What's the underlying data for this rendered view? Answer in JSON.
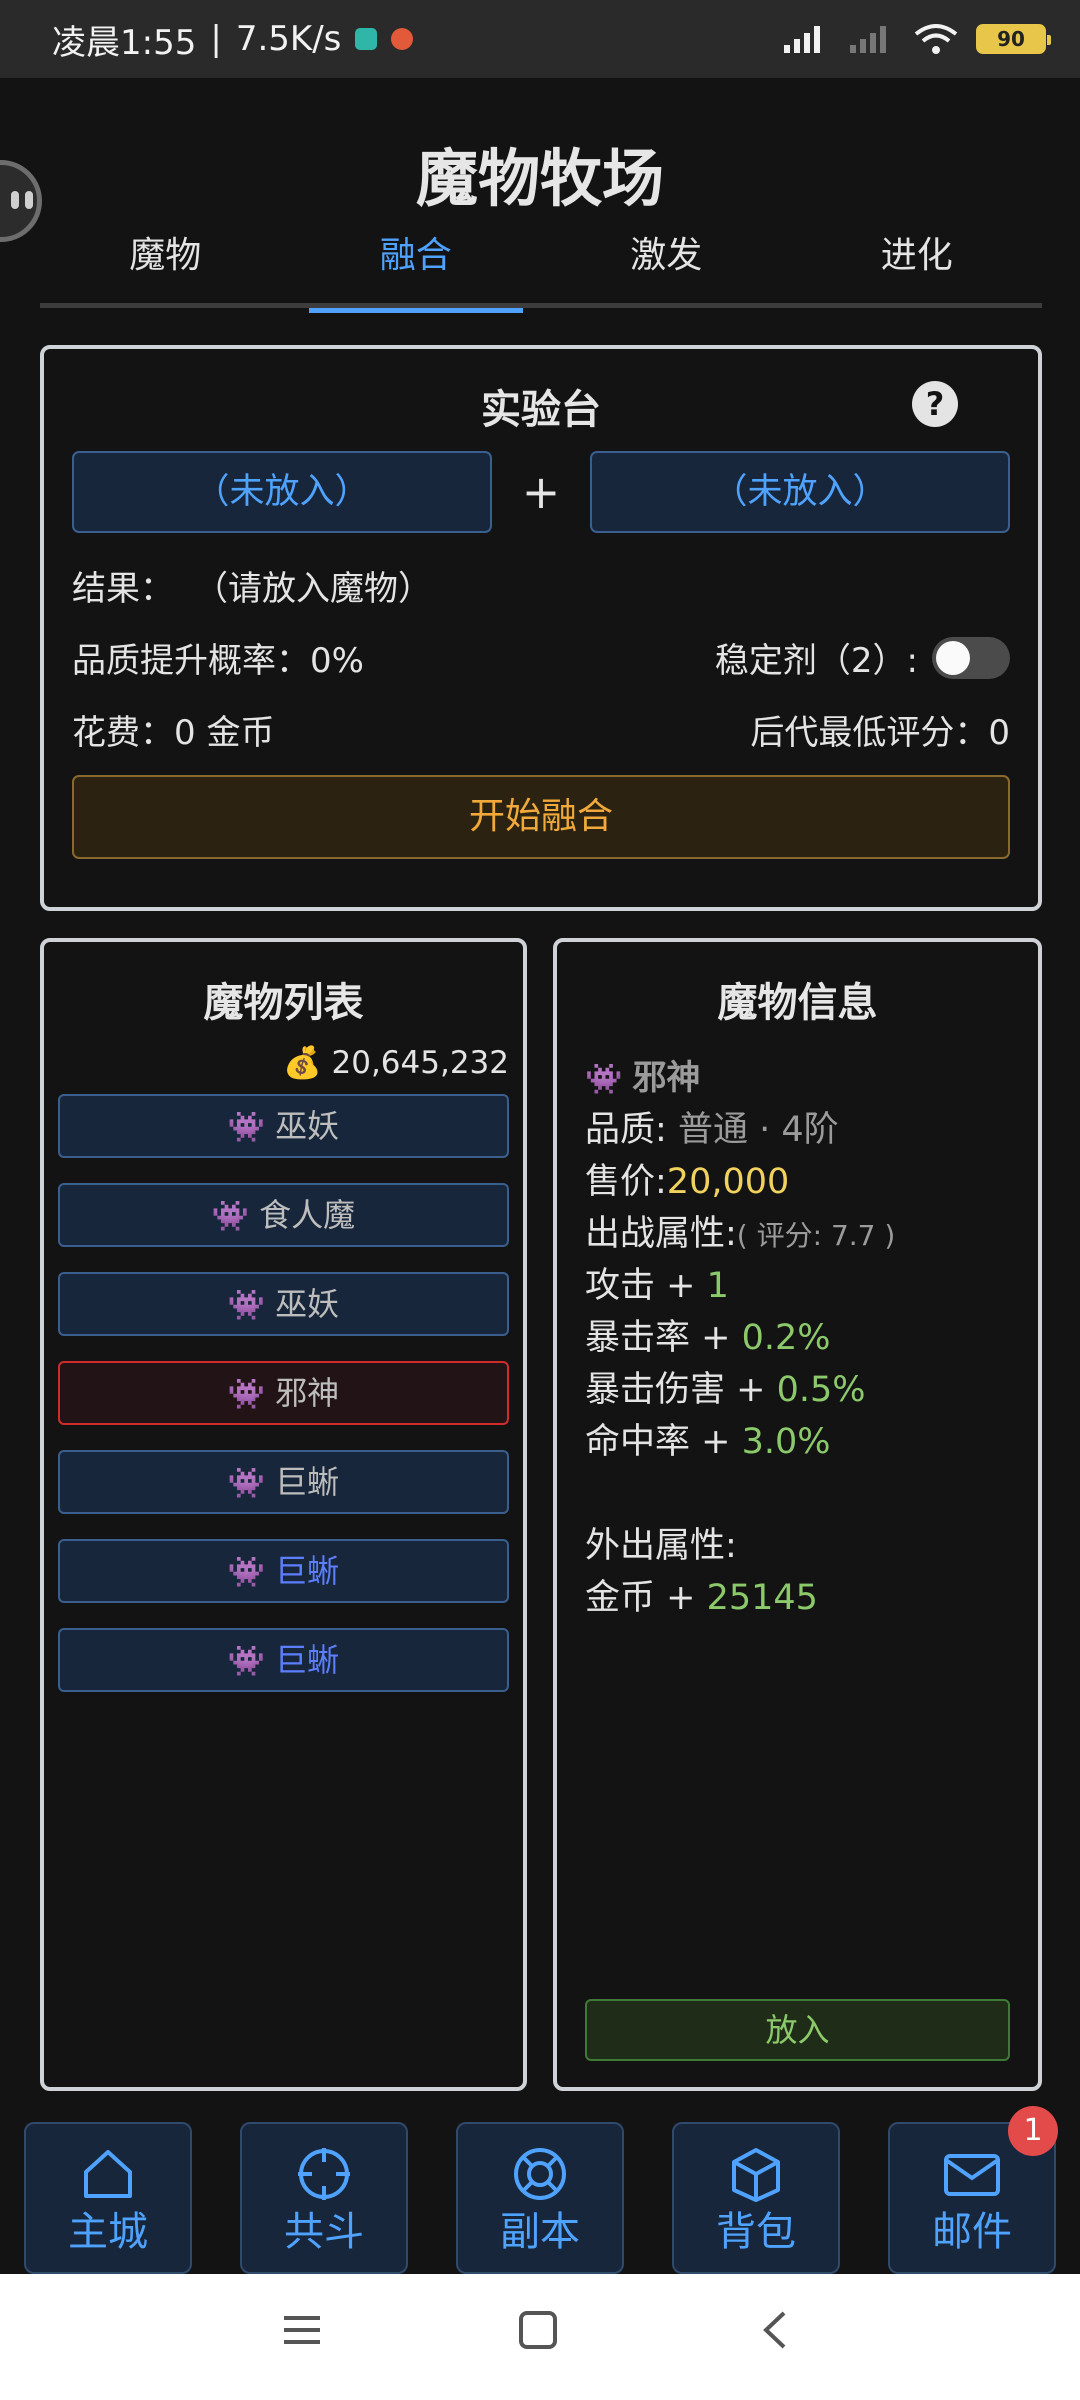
{
  "status_bar": {
    "time": "凌晨1:55",
    "speed": "7.5K/s",
    "battery": "90"
  },
  "page_title": "魔物牧场",
  "tabs": [
    {
      "label": "魔物"
    },
    {
      "label": "融合"
    },
    {
      "label": "激发"
    },
    {
      "label": "进化"
    }
  ],
  "lab": {
    "title": "实验台",
    "help": "?",
    "slot_a": "（未放入）",
    "plus": "+",
    "slot_b": "（未放入）",
    "result_label": "结果：",
    "result_value": "（请放入魔物）",
    "quality_rate": "品质提升概率：0%",
    "stabilizer": "稳定剂（2）:",
    "stabilizer_on": false,
    "cost": "花费：0 金币",
    "min_score": "后代最低评分：0",
    "start_button": "开始融合"
  },
  "monster_list": {
    "title": "魔物列表",
    "gold_icon": "💰",
    "gold": "20,645,232",
    "items": [
      {
        "icon": "👾",
        "name": "巫妖"
      },
      {
        "icon": "👾",
        "name": "食人魔"
      },
      {
        "icon": "👾",
        "name": "巫妖"
      },
      {
        "icon": "👾",
        "name": "邪神"
      },
      {
        "icon": "👾",
        "name": "巨蜥"
      },
      {
        "icon": "👾",
        "name": "巨蜥"
      },
      {
        "icon": "👾",
        "name": "巨蜥"
      }
    ],
    "selected_index": 3
  },
  "monster_info": {
    "title": "魔物信息",
    "icon": "👾",
    "name": "邪神",
    "quality_label": "品质:",
    "quality_value": "普通 · 4阶",
    "price_label": "售价:",
    "price_value": "20,000",
    "battle_attr_label": "出战属性:",
    "battle_score": "( 评分: 7.7 )",
    "attack_label": "攻击 +",
    "attack_value": "1",
    "crit_rate_label": "暴击率 +",
    "crit_rate_value": "0.2%",
    "crit_dmg_label": "暴击伤害 +",
    "crit_dmg_value": "0.5%",
    "hit_label": "命中率 +",
    "hit_value": "3.0%",
    "outing_attr_label": "外出属性:",
    "gold_label": "金币 +",
    "gold_value": "25145",
    "put_button": "放入"
  },
  "bottom_nav": [
    {
      "icon": "home-icon",
      "label": "主城"
    },
    {
      "icon": "crosshair-icon",
      "label": "共斗"
    },
    {
      "icon": "lifebuoy-icon",
      "label": "副本"
    },
    {
      "icon": "box-icon",
      "label": "背包"
    },
    {
      "icon": "mail-icon",
      "label": "邮件",
      "badge": "1"
    }
  ],
  "colors": {
    "accent": "#4fa3ff",
    "bg": "#131313",
    "gold": "#f0a93a",
    "green": "#8bc96a",
    "red": "#d22b2b"
  }
}
